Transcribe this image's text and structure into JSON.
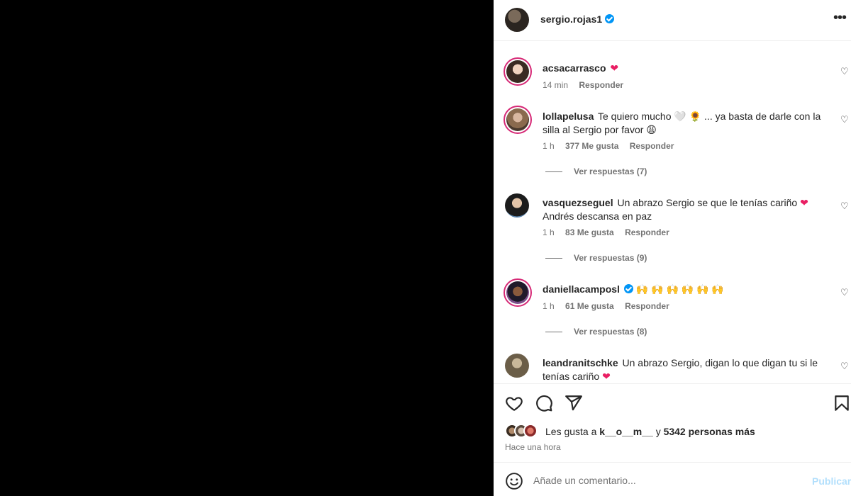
{
  "post": {
    "author": "sergio.rojas1",
    "more_icon": "more-horizontal-icon"
  },
  "comments": [
    {
      "user": "acsacarrasco",
      "text": "",
      "emoji": "❤",
      "time": "14 min",
      "likes": "",
      "reply": "Responder",
      "replies": ""
    },
    {
      "user": "lollapelusa",
      "text": "Te quiero mucho 🤍 🌻 ... ya basta de darle con la silla al Sergio por favor 😩",
      "emoji": "",
      "time": "1 h",
      "likes": "377 Me gusta",
      "reply": "Responder",
      "replies": "Ver respuestas (7)"
    },
    {
      "user": "vasquezseguel",
      "text": "Un abrazo Sergio se que le tenías cariño",
      "text2": "Andrés descansa en paz",
      "emoji": "❤",
      "time": "1 h",
      "likes": "83 Me gusta",
      "reply": "Responder",
      "replies": "Ver respuestas (9)"
    },
    {
      "user": "daniellacamposl",
      "text": "🙌 🙌 🙌 🙌 🙌 🙌",
      "emoji": "",
      "time": "1 h",
      "likes": "61 Me gusta",
      "reply": "Responder",
      "replies": "Ver respuestas (8)"
    },
    {
      "user": "leandranitschke",
      "text": "Un abrazo Sergio, digan lo que digan tu si le tenías cariño",
      "emoji": "❤",
      "time": "",
      "likes": "",
      "reply": "",
      "replies": ""
    }
  ],
  "actions": {
    "like_icon": "heart-icon",
    "comment_icon": "comment-icon",
    "share_icon": "share-icon",
    "save_icon": "bookmark-icon"
  },
  "likes": {
    "prefix": "Les gusta a",
    "user": "k__o__m__",
    "connector": "y",
    "others": "5342 personas más"
  },
  "timeago": "Hace una hora",
  "add_comment": {
    "placeholder": "Añade un comentario...",
    "publish": "Publicar",
    "emoji_icon": "smile-icon"
  },
  "colors": {
    "accent": "#0095f6",
    "publish_disabled": "#b2dffc",
    "heart": "#e91e63"
  }
}
